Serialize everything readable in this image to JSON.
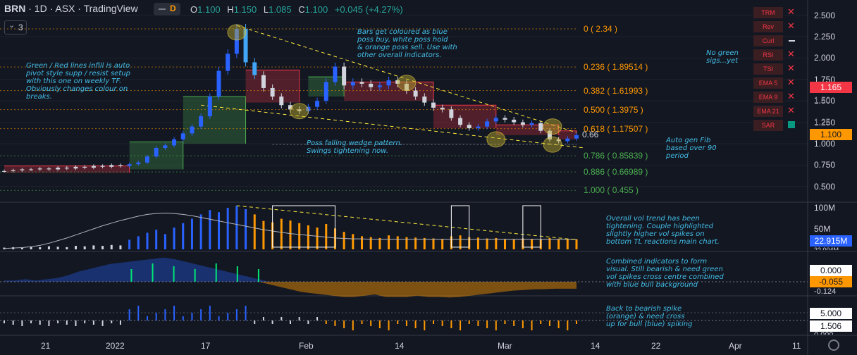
{
  "header": {
    "symbol": "BRN",
    "interval": "1D",
    "exchange": "ASX",
    "platform": "TradingView",
    "interval_badge": "D",
    "indicator_count": "3",
    "ohlc": {
      "o_label": "O",
      "o": "1.100",
      "h_label": "H",
      "h": "1.150",
      "l_label": "L",
      "l": "1.085",
      "c_label": "C",
      "c": "1.100",
      "change": "+0.045 (+4.27%)"
    }
  },
  "legend": [
    {
      "name": "TRM",
      "state": "x"
    },
    {
      "name": "Rev",
      "state": "x"
    },
    {
      "name": "Curl",
      "state": "dash"
    },
    {
      "name": "RSI",
      "state": "x"
    },
    {
      "name": "TSI",
      "state": "x"
    },
    {
      "name": "EMA 5",
      "state": "x"
    },
    {
      "name": "EMA 9",
      "state": "x"
    },
    {
      "name": "EMA 21",
      "state": "x"
    },
    {
      "name": "SAR",
      "state": "check"
    }
  ],
  "annotations": {
    "pivot": "Green / Red lines infill is auto\npivot style supp / resist setup\nwith this one on weekly TF.\nObviously changes colour on\nbreaks.",
    "bars": "Bars get coloured as blue\nposs buy, white poss hold\n& orange poss sell. Use with\nother overall indicators.",
    "no_green": "No green\nsigs...yet",
    "wedge": "Poss falling wedge pattern.\nSwings tightening now.",
    "fib": "Auto gen Fib\nbased over 90\nperiod",
    "vol": "Overall vol trend has been\ntightening. Couple highlighted\nslightly higher vol spikes on\nbottom TL reactions main chart.",
    "combined": "Combined indicators to form\nvisual. Still bearish & need green\nvol spikes cross centre combined\nwith blue bull background",
    "spike": "Back to bearish spike\n(orange) & need cross\nup for bull (blue) spiking"
  },
  "price_axis": {
    "ticks": [
      "2.500",
      "2.250",
      "2.000",
      "1.750",
      "1.500",
      "1.250",
      "1.000",
      "0.750",
      "0.500"
    ],
    "partial_ticks": [
      "1.50",
      "1.25"
    ],
    "last_price": "1.100",
    "ema_value": "1.165",
    "level_066": "0.66"
  },
  "volume_axis": {
    "ticks": [
      "100M",
      "50M"
    ],
    "current": "22.915M",
    "partial": "22.004M"
  },
  "combined_axis": {
    "values": [
      "0.000",
      "-0.055",
      "-0.124"
    ]
  },
  "spike_axis": {
    "values": [
      "5.000",
      "1.506"
    ],
    "partial": "0.000"
  },
  "time_axis": [
    "21",
    "2022",
    "17",
    "Feb",
    "14",
    "Mar",
    "14",
    "22",
    "Apr",
    "11"
  ],
  "fib_levels": [
    {
      "level": "0",
      "price": "2.34",
      "text": "0 ( 2.34 )",
      "value": 2.34,
      "color": "#ff9800"
    },
    {
      "level": "0.236",
      "price": "1.89514",
      "text": "0.236 ( 1.89514 )",
      "value": 1.89514,
      "color": "#ff9800"
    },
    {
      "level": "0.382",
      "price": "1.61993",
      "text": "0.382 ( 1.61993 )",
      "value": 1.61993,
      "color": "#ff9800"
    },
    {
      "level": "0.500",
      "price": "1.3975",
      "text": "0.500 ( 1.3975 )",
      "value": 1.3975,
      "color": "#ff9800"
    },
    {
      "level": "0.618",
      "price": "1.17507",
      "text": "0.618 ( 1.17507 )",
      "value": 1.17507,
      "color": "#ff9800"
    },
    {
      "level": "0.786",
      "price": "0.85839",
      "text": "0.786 ( 0.85839 )",
      "value": 0.85839,
      "color": "#4caf50"
    },
    {
      "level": "0.886",
      "price": "0.66989",
      "text": "0.886 ( 0.66989 )",
      "value": 0.66989,
      "color": "#4caf50"
    },
    {
      "level": "1.000",
      "price": "0.455",
      "text": "1.000 ( 0.455 )",
      "value": 0.455,
      "color": "#4caf50"
    }
  ],
  "chart_data": {
    "type": "candlestick",
    "title": "BRN · 1D · ASX",
    "ylim": [
      0.35,
      2.62
    ],
    "close_series": [
      0.68,
      0.69,
      0.7,
      0.7,
      0.71,
      0.7,
      0.72,
      0.71,
      0.73,
      0.72,
      0.74,
      0.73,
      0.75,
      0.74,
      0.76,
      0.78,
      0.85,
      0.95,
      0.98,
      1.05,
      1.12,
      1.2,
      1.32,
      1.55,
      1.85,
      2.05,
      2.34,
      1.95,
      1.8,
      1.65,
      1.55,
      1.45,
      1.4,
      1.38,
      1.43,
      1.5,
      1.72,
      1.9,
      1.68,
      1.72,
      1.7,
      1.66,
      1.68,
      1.74,
      1.7,
      1.62,
      1.55,
      1.48,
      1.42,
      1.4,
      1.3,
      1.22,
      1.18,
      1.2,
      1.26,
      1.3,
      1.28,
      1.25,
      1.22,
      1.24,
      1.15,
      1.05,
      1.03,
      1.06,
      1.1
    ],
    "fib": {
      "high": 2.34,
      "low": 0.455,
      "period": 90
    },
    "volume_M": [
      4,
      5,
      4,
      6,
      5,
      7,
      6,
      5,
      8,
      7,
      9,
      8,
      10,
      9,
      22,
      30,
      38,
      45,
      35,
      50,
      60,
      70,
      80,
      90,
      85,
      95,
      100,
      92,
      80,
      65,
      62,
      70,
      66,
      60,
      55,
      50,
      58,
      48,
      40,
      35,
      30,
      28,
      26,
      32,
      30,
      28,
      27,
      26,
      25,
      24,
      30,
      32,
      28,
      27,
      25,
      26,
      24,
      23,
      25,
      24,
      22,
      26,
      24,
      23,
      22.915
    ],
    "volume_trend_M": [
      2,
      3,
      4,
      6,
      9,
      14,
      20,
      26,
      33,
      40,
      47,
      54,
      60,
      66,
      71,
      76,
      80,
      82,
      83,
      82,
      80,
      77,
      73,
      69,
      65,
      61,
      57,
      53,
      49,
      45,
      42,
      39,
      36,
      34,
      32,
      30,
      28,
      26,
      25,
      24,
      24,
      23,
      23,
      23,
      23,
      23,
      23,
      23,
      23,
      23,
      23,
      23,
      23,
      23,
      23,
      23,
      23,
      23,
      23,
      23,
      23,
      23,
      23,
      23,
      23
    ],
    "combined_indicator": [
      0.01,
      0.01,
      0.02,
      0.01,
      0.02,
      0.03,
      0.05,
      0.08,
      0.1,
      0.12,
      0.14,
      0.15,
      0.16,
      0.17,
      0.18,
      0.19,
      0.18,
      0.16,
      0.14,
      0.12,
      0.1,
      0.08,
      0.06,
      0.04,
      0.02,
      -0.02,
      -0.04,
      -0.06,
      -0.08,
      -0.09,
      -0.1,
      -0.11,
      -0.12,
      -0.12,
      -0.11,
      -0.1,
      -0.12,
      -0.12,
      -0.12,
      -0.11,
      -0.12,
      -0.12,
      -0.124,
      -0.12,
      -0.11,
      -0.1,
      -0.09,
      -0.08,
      -0.07,
      -0.065,
      -0.06,
      -0.058,
      -0.055,
      -0.055,
      -0.055
    ],
    "spike_ylim": [
      0,
      5
    ],
    "series": [
      {
        "name": "BRN price"
      },
      {
        "name": "Volume"
      },
      {
        "name": "Combined"
      },
      {
        "name": "Spike"
      }
    ]
  }
}
